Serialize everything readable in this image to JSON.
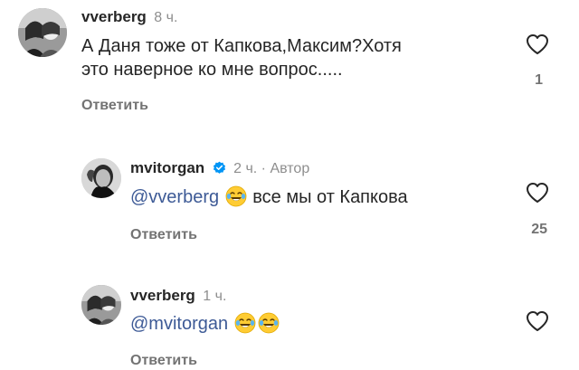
{
  "comments": [
    {
      "username": "vverberg",
      "time": "8 ч.",
      "text_line1": "А Даня тоже от Капкова,Максим?Хотя",
      "text_line2": "это наверное ко мне вопрос.....",
      "reply_label": "Ответить",
      "likes": "1",
      "avatar": "two-people-avatar"
    },
    {
      "username": "mvitorgan",
      "time": "2 ч.",
      "separator": "·",
      "author_label": "Автор",
      "verified": true,
      "mention": "@vverberg",
      "emoji": [
        "laughing-tears-emoji"
      ],
      "text": "все мы от Капкова",
      "reply_label": "Ответить",
      "likes": "25",
      "avatar": "man-portrait-avatar"
    },
    {
      "username": "vverberg",
      "time": "1 ч.",
      "mention": "@mvitorgan",
      "emoji": [
        "laughing-tears-emoji",
        "laughing-tears-emoji"
      ],
      "reply_label": "Ответить",
      "avatar": "two-people-avatar"
    }
  ],
  "colors": {
    "text": "#262626",
    "secondary": "#8e8e8e",
    "mention": "#3d5a96",
    "verified": "#0095f6"
  },
  "icons": {
    "like": "heart-outline-icon",
    "verified": "verified-badge-icon"
  }
}
